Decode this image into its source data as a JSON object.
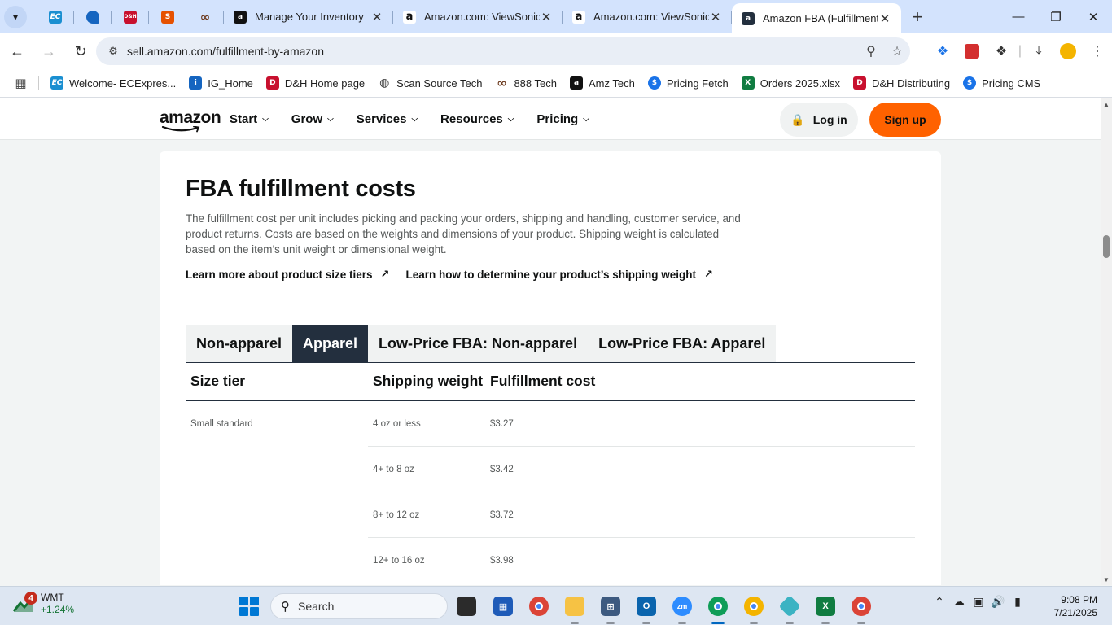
{
  "browser": {
    "tabs": [
      {
        "title": "Manage Your Inventory",
        "favicon": "amazon"
      },
      {
        "title": "Amazon.com: ViewSonic G",
        "favicon": "amazon"
      },
      {
        "title": "Amazon.com: ViewSonic V",
        "favicon": "amazon"
      },
      {
        "title": "Amazon FBA (Fulfillment b",
        "favicon": "amazon",
        "active": true
      }
    ],
    "pinned_tabs": [
      {
        "icon": "ec-icon",
        "label": "EC",
        "color": "#1a8fd1"
      },
      {
        "icon": "blue-app-icon",
        "label": "",
        "color": "#1565c0"
      },
      {
        "icon": "dh-icon",
        "label": "D&H",
        "color": "#c8102e"
      },
      {
        "icon": "s-icon",
        "label": "S",
        "color": "#e65100"
      },
      {
        "icon": "888-icon",
        "label": "",
        "color": "#6d3b1f"
      }
    ],
    "url": "sell.amazon.com/fulfillment-by-amazon",
    "bookmarks": [
      {
        "label": "Welcome- ECExpres...",
        "color": "#1a8fd1",
        "glyph": "EC"
      },
      {
        "label": "IG_Home",
        "color": "#1565c0",
        "glyph": "i"
      },
      {
        "label": "D&H Home page",
        "color": "#c8102e",
        "glyph": "D"
      },
      {
        "label": "Scan Source Tech",
        "color": "#333333",
        "glyph": "◍"
      },
      {
        "label": "888 Tech",
        "color": "#6d3b1f",
        "glyph": "∞"
      },
      {
        "label": "Amz Tech",
        "color": "#111111",
        "glyph": "a"
      },
      {
        "label": "Pricing Fetch",
        "color": "#1a73e8",
        "glyph": "$"
      },
      {
        "label": "Orders 2025.xlsx",
        "color": "#107c41",
        "glyph": "X"
      },
      {
        "label": "D&H Distributing",
        "color": "#c8102e",
        "glyph": "D"
      },
      {
        "label": "Pricing CMS",
        "color": "#1a73e8",
        "glyph": "$"
      }
    ]
  },
  "site": {
    "logo": "amazon",
    "nav": [
      {
        "label": "Start"
      },
      {
        "label": "Grow"
      },
      {
        "label": "Services"
      },
      {
        "label": "Resources"
      },
      {
        "label": "Pricing"
      }
    ],
    "login": "Log in",
    "signup": "Sign up",
    "brand_orange": "#ff6200"
  },
  "content": {
    "title": "FBA fulfillment costs",
    "intro": "The fulfillment cost per unit includes picking and packing your orders, shipping and handling, customer service, and product returns. Costs are based on the weights and dimensions of your product. Shipping weight is calculated based on the item’s unit weight or dimensional weight.",
    "links": [
      {
        "label": "Learn more about product size tiers"
      },
      {
        "label": "Learn how to determine your product’s shipping weight"
      }
    ],
    "tabs": [
      {
        "label": "Non-apparel"
      },
      {
        "label": "Apparel",
        "active": true
      },
      {
        "label": "Low-Price FBA: Non-apparel"
      },
      {
        "label": "Low-Price FBA: Apparel"
      }
    ],
    "table": {
      "headers": [
        "Size tier",
        "Shipping weight",
        "Fulfillment cost"
      ],
      "rows": [
        {
          "tier": "Small standard",
          "weight": "4 oz or less",
          "cost": "$3.27"
        },
        {
          "tier": "",
          "weight": "4+ to 8 oz",
          "cost": "$3.42"
        },
        {
          "tier": "",
          "weight": "8+ to 12 oz",
          "cost": "$3.72"
        },
        {
          "tier": "",
          "weight": "12+ to 16 oz",
          "cost": "$3.98"
        }
      ]
    }
  },
  "taskbar": {
    "stock": {
      "ticker": "WMT",
      "change": "+1.24%",
      "badge": "4"
    },
    "search_placeholder": "Search",
    "time": "9:08 PM",
    "date": "7/21/2025"
  }
}
